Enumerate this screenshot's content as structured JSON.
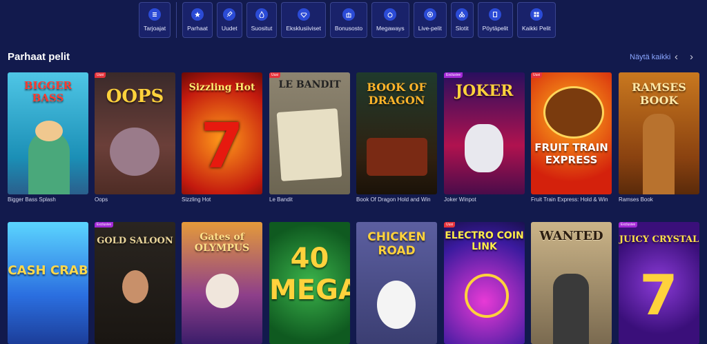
{
  "categories": [
    {
      "label": "Tarjoajat",
      "icon": "list-icon"
    },
    {
      "label": "Parhaat",
      "icon": "star-icon"
    },
    {
      "label": "Uudet",
      "icon": "rocket-icon"
    },
    {
      "label": "Suositut",
      "icon": "flame-icon"
    },
    {
      "label": "Eksklusiiviset",
      "icon": "diamond-icon"
    },
    {
      "label": "Bonusosto",
      "icon": "gift-icon"
    },
    {
      "label": "Megaways",
      "icon": "money-bag-icon"
    },
    {
      "label": "Live-pelit",
      "icon": "live-icon"
    },
    {
      "label": "Slotit",
      "icon": "cherries-icon"
    },
    {
      "label": "Pöytäpelit",
      "icon": "cards-icon"
    },
    {
      "label": "Kaikki Pelit",
      "icon": "grid-icon"
    }
  ],
  "section": {
    "title": "Parhaat pelit",
    "show_all": "Näytä kaikki"
  },
  "games_row1": [
    {
      "name": "Bigger Bass Splash",
      "art": "BIGGER BASS",
      "badge": ""
    },
    {
      "name": "Oops",
      "art": "OOPS",
      "badge": "Uusi"
    },
    {
      "name": "Sizzling Hot",
      "art": "Sizzling Hot",
      "badge": ""
    },
    {
      "name": "Le Bandit",
      "art": "LE BANDIT",
      "badge": "Uusi"
    },
    {
      "name": "Book Of Dragon Hold and Win",
      "art": "BOOK OF DRAGON",
      "badge": ""
    },
    {
      "name": "Joker Winpot",
      "art": "JOKER",
      "badge": "Exclusive"
    },
    {
      "name": "Fruit Train Express: Hold & Win",
      "art": "FRUIT TRAIN EXPRESS",
      "badge": "Uusi"
    },
    {
      "name": "Ramses Book",
      "art": "RAMSES BOOK",
      "badge": ""
    }
  ],
  "games_row2": [
    {
      "art": "CASH CRAB",
      "badge": ""
    },
    {
      "art": "GOLD SALOON",
      "badge": "Exclusive"
    },
    {
      "art": "Gates of OLYMPUS",
      "badge": ""
    },
    {
      "art": "40 MEGA",
      "badge": ""
    },
    {
      "art": "CHICKEN ROAD",
      "badge": ""
    },
    {
      "art": "ELECTRO COIN LINK",
      "badge": "Uusi"
    },
    {
      "art": "WANTED",
      "badge": ""
    },
    {
      "art": "JUICY CRYSTAL",
      "badge": "Exclusive"
    }
  ],
  "colors": {
    "background": "#121a4d",
    "accent": "#2b4bd6",
    "link": "#8ba7ff",
    "badge": "#e5333b"
  }
}
